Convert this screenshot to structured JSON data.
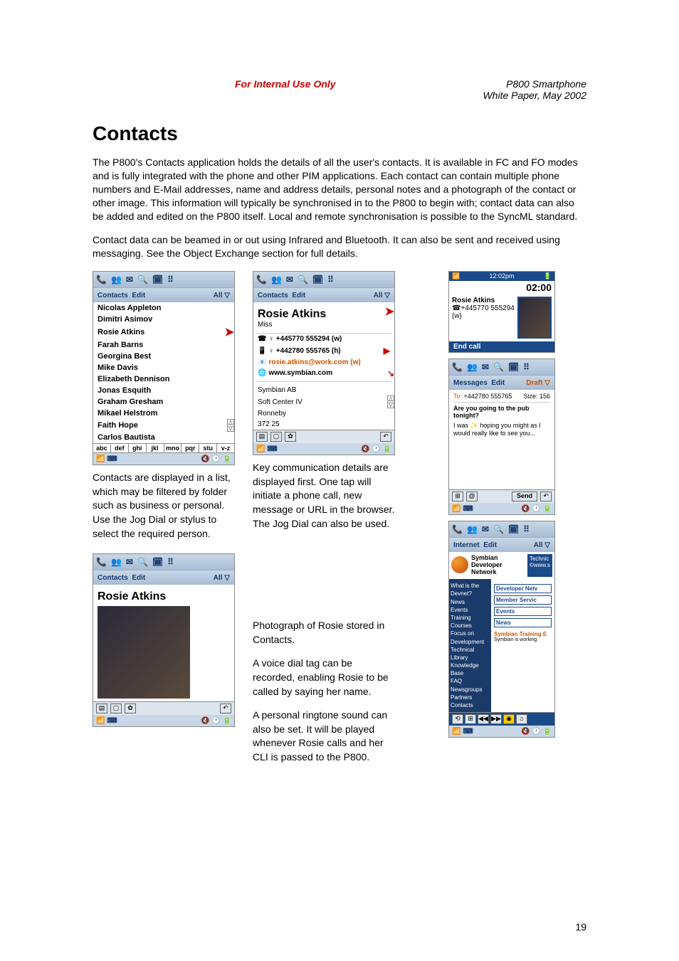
{
  "header": {
    "internal": "For Internal Use Only",
    "product": "P800 Smartphone",
    "subtitle": "White Paper, May 2002"
  },
  "title": "Contacts",
  "para1": "The P800's Contacts application holds the details of all the user's contacts. It is available in FC and FO modes and is fully integrated with the phone and other PIM applications. Each contact can contain multiple phone numbers and E-Mail addresses, name and address details, personal notes and a photograph of the contact or other image. This information will typically be synchronised in to the P800 to begin with; contact data can also be added and edited on the P800 itself. Local and remote synchronisation is possible to the SyncML standard.",
  "para2": "Contact data can be beamed in or out using Infrared and Bluetooth. It can also be sent and received using messaging. See the Object Exchange section for full details.",
  "screens": {
    "menu_contacts": "Contacts",
    "menu_edit": "Edit",
    "menu_all": "All ▽",
    "menu_messages": "Messages",
    "menu_internet": "Internet",
    "menu_draft": "Draft ▽"
  },
  "contact_list": [
    "Nicolas Appleton",
    "Dimitri Asimov",
    "Rosie Atkins",
    "Farah Barns",
    "Georgina Best",
    "Mike Davis",
    "Elizabeth Dennison",
    "Jonas Esquith",
    "Graham Gresham",
    "Mikael Helstrom",
    "Faith Hope",
    "Carlos Bautista"
  ],
  "alpha": [
    "abc",
    "def",
    "ghi",
    "jkl",
    "mno",
    "pqr",
    "stu",
    "v-z"
  ],
  "detail": {
    "name": "Rosie Atkins",
    "honorific": "Miss",
    "phone_w": "+445770 555294 (w)",
    "phone_h": "+442780 555765 (h)",
    "email": "rosie.atkins@work.com (w)",
    "url": "www.symbian.com",
    "addr1": "Symbian AB",
    "addr2": "Soft Center IV",
    "addr3": "Ronneby",
    "addr4": "372 25"
  },
  "call": {
    "time_top": "12:02pm",
    "time_big": "02:00",
    "name": "Rosie Atkins",
    "number": "+445770 555294 (w)",
    "end": "End call"
  },
  "msg": {
    "to_label": "To:",
    "to_num": "+442780 555765",
    "size": "Size: 156",
    "line1": "Are you going to the pub tonight?",
    "line2": "I was",
    "line2b": "hoping you might as I would really like to see you...",
    "send": "Send"
  },
  "web": {
    "brand1": "Symbian",
    "brand2": "Developer",
    "brand3": "Network",
    "right_label": "Technic",
    "right_url": "©www.s",
    "boxes": [
      "Developer Netv",
      "Member Servic",
      "Events",
      "News",
      "Symbian Training E"
    ],
    "side": [
      "What is the Devnet?",
      "News",
      "Events",
      "Training Courses",
      "Focus on Development",
      "Technical Library",
      "Knowledge Base",
      "FAQ",
      "Newsgroups",
      "Partners",
      "Contacts"
    ],
    "working": "Symbian is working"
  },
  "captions": {
    "c1": "Contacts are displayed in a list, which may be filtered by folder such as business or personal. Use the Jog Dial or stylus to select the required person.",
    "c2": "Key communication details are displayed first. One tap will initiate a phone call, new message or URL in the browser. The Jog Dial can also be used.",
    "c3a": "Photograph of Rosie stored in Contacts.",
    "c3b": "A voice dial tag can be recorded, enabling Rosie to be called by saying her name.",
    "c3c": "A personal ringtone sound can also be set. It will be played whenever Rosie calls and her CLI is passed to the P800."
  },
  "page_number": "19"
}
